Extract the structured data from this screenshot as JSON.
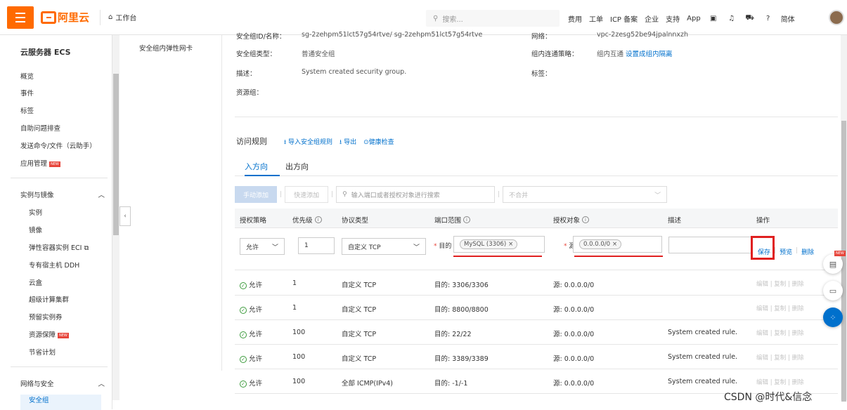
{
  "topbar": {
    "brand": "阿里云",
    "workbench": "工作台",
    "search_placeholder": "搜索...",
    "links": [
      "费用",
      "工单",
      "ICP 备案",
      "企业",
      "支持",
      "App"
    ],
    "lang": "简体",
    "accent_color": "#ff6a00"
  },
  "sidebar": {
    "title": "云服务器 ECS",
    "items_top": [
      "概览",
      "事件",
      "标签",
      "自助问题排查",
      "发送命令/文件（云助手）",
      "应用管理"
    ],
    "new_badge": "NEW",
    "group1": "实例与镜像",
    "group1_items": [
      "实例",
      "镜像",
      "弹性容器实例 ECI ⧉",
      "专有宿主机 DDH",
      "云盒",
      "超级计算集群",
      "预留实例券",
      "资源保障",
      "节省计划"
    ],
    "group2": "网络与安全",
    "group2_first": "安全组"
  },
  "subnav": {
    "item": "安全组内弹性网卡"
  },
  "info": {
    "row0_label": "安全组ID/名称：",
    "row0_value": "sg-2zehpm51lct57g54rtve/ sg-2zehpm51lct57g54rtve",
    "row0_right_label": "网络：",
    "row0_right_value": "vpc-2zesg52be94jpalnnxzh",
    "type_label": "安全组类型：",
    "type_value": "普通安全组",
    "policy_label": "组内连通策略：",
    "policy_value": "组内互通",
    "policy_link": "设置成组内隔离",
    "desc_label": "描述：",
    "desc_value": "System created security group.",
    "tag_label": "标签：",
    "rg_label": "资源组："
  },
  "rules": {
    "title": "访问规则",
    "actions": [
      "导入安全组规则",
      "导出",
      "健康检查"
    ],
    "tabs": [
      "入方向",
      "出方向"
    ],
    "btn_manual": "手动添加",
    "btn_quick": "快速添加",
    "search_placeholder": "输入端口或者授权对象进行搜索",
    "merge_select": "不合并",
    "headers": [
      "授权策略",
      "优先级",
      "协议类型",
      "端口范围",
      "授权对象",
      "描述",
      "操作"
    ],
    "edit": {
      "policy": "允许",
      "priority": "1",
      "protocol": "自定义 TCP",
      "port_prefix": "目的",
      "port_tag": "MySQL (3306)",
      "source_prefix": "源:",
      "source_tag": "0.0.0.0/0",
      "save": "保存",
      "preview": "预览",
      "delete": "删除"
    },
    "rows": [
      {
        "policy": "允许",
        "priority": "1",
        "protocol": "自定义 TCP",
        "port": "目的: 3306/3306",
        "source": "源: 0.0.0.0/0",
        "desc": ""
      },
      {
        "policy": "允许",
        "priority": "1",
        "protocol": "自定义 TCP",
        "port": "目的: 8800/8800",
        "source": "源: 0.0.0.0/0",
        "desc": ""
      },
      {
        "policy": "允许",
        "priority": "100",
        "protocol": "自定义 TCP",
        "port": "目的: 22/22",
        "source": "源: 0.0.0.0/0",
        "desc": "System created rule."
      },
      {
        "policy": "允许",
        "priority": "100",
        "protocol": "自定义 TCP",
        "port": "目的: 3389/3389",
        "source": "源: 0.0.0.0/0",
        "desc": "System created rule."
      },
      {
        "policy": "允许",
        "priority": "100",
        "protocol": "全部 ICMP(IPv4)",
        "port": "目的: -1/-1",
        "source": "源: 0.0.0.0/0",
        "desc": "System created rule."
      }
    ],
    "row_ops": [
      "编辑",
      "复制",
      "删除"
    ]
  },
  "watermark": "CSDN @时代&信念"
}
